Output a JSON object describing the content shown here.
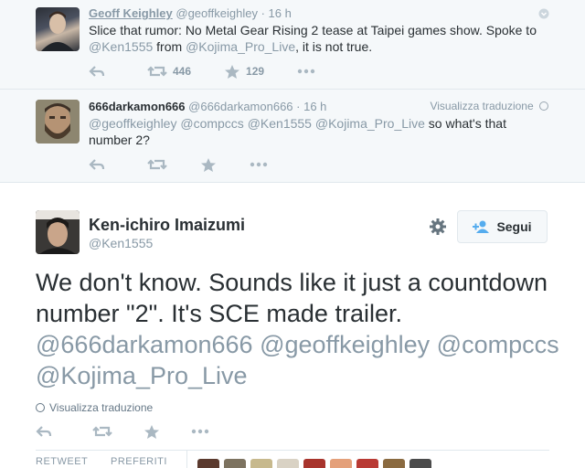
{
  "tweets": [
    {
      "name": "Geoff Keighley",
      "handle": "@geoffkeighley",
      "time": "· 16 h",
      "text_parts": [
        "Slice that rumor: No Metal Gear Rising 2 tease at Taipei games show. Spoke to ",
        "@Ken1555",
        " from ",
        "@Kojima_Pro_Live",
        ", it is not true."
      ],
      "retweets": "446",
      "favorites": "129"
    },
    {
      "name": "666darkamon666",
      "handle": "@666darkamon666",
      "time": "· 16 h",
      "translate": "Visualizza traduzione",
      "text_parts": [
        "@geoffkeighley",
        " ",
        "@compccs",
        " ",
        "@Ken1555",
        " ",
        "@Kojima_Pro_Live",
        " so what's that number 2?"
      ]
    }
  ],
  "main": {
    "name": "Ken-ichiro Imaizumi",
    "handle": "@Ken1555",
    "follow_label": "Segui",
    "text_parts": [
      "We don't know. Sounds like it just a countdown number \"2\". It's SCE made trailer. ",
      "@666darkamon666",
      " ",
      "@geoffkeighley",
      " ",
      "@compccs",
      " ",
      "@Kojima_Pro_Live"
    ],
    "translate": "Visualizza traduzione",
    "stats": {
      "retweet_label": "RETWEET",
      "favorites_label": "PREFERITI"
    }
  },
  "colors": {
    "text": "#292f33",
    "muted": "#8899a6",
    "bg_context": "#f5f8fa",
    "border": "#e1e8ed",
    "icon": "#aab8c2"
  },
  "icons": [
    "reply-icon",
    "retweet-icon",
    "favorite-icon",
    "more-icon",
    "globe-icon",
    "gear-icon",
    "follow-user-icon",
    "dropdown-chevron-icon"
  ]
}
